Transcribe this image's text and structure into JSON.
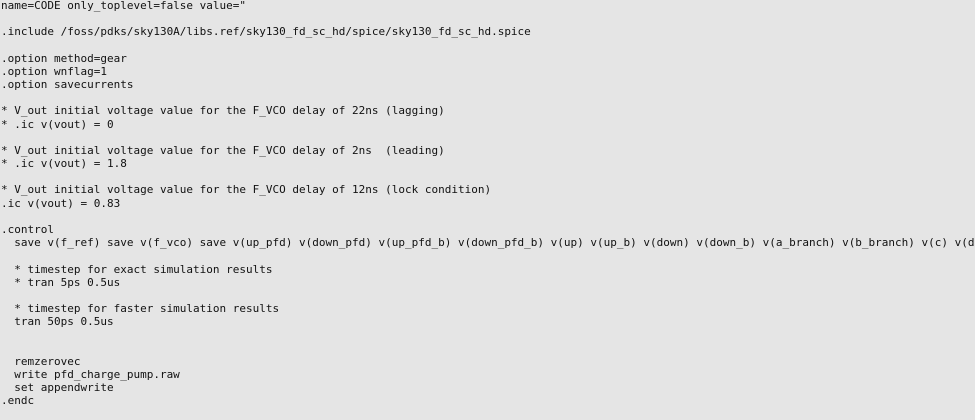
{
  "editor": {
    "lines": [
      "name=CODE only_toplevel=false value=\"",
      "",
      ".include /foss/pdks/sky130A/libs.ref/sky130_fd_sc_hd/spice/sky130_fd_sc_hd.spice",
      "",
      ".option method=gear",
      ".option wnflag=1",
      ".option savecurrents",
      "",
      "* V_out initial voltage value for the F_VCO delay of 22ns (lagging)",
      "* .ic v(vout) = 0",
      "",
      "* V_out initial voltage value for the F_VCO delay of 2ns  (leading)",
      "* .ic v(vout) = 1.8",
      "",
      "* V_out initial voltage value for the F_VCO delay of 12ns (lock condition)",
      ".ic v(vout) = 0.83",
      "",
      ".control",
      "  save v(f_ref) save v(f_vco) save v(up_pfd) v(down_pfd) v(up_pfd_b) v(down_pfd_b) v(up) v(up_b) v(down) v(down_b) v(a_branch) v(b_branch) v(c) v(d) v(vout)",
      "",
      "  * timestep for exact simulation results",
      "  * tran 5ps 0.5us",
      "",
      "  * timestep for faster simulation results",
      "  tran 50ps 0.5us",
      "",
      "",
      "  remzerovec",
      "  write pfd_charge_pump.raw",
      "  set appendwrite",
      ".endc",
      "",
      "\""
    ]
  }
}
